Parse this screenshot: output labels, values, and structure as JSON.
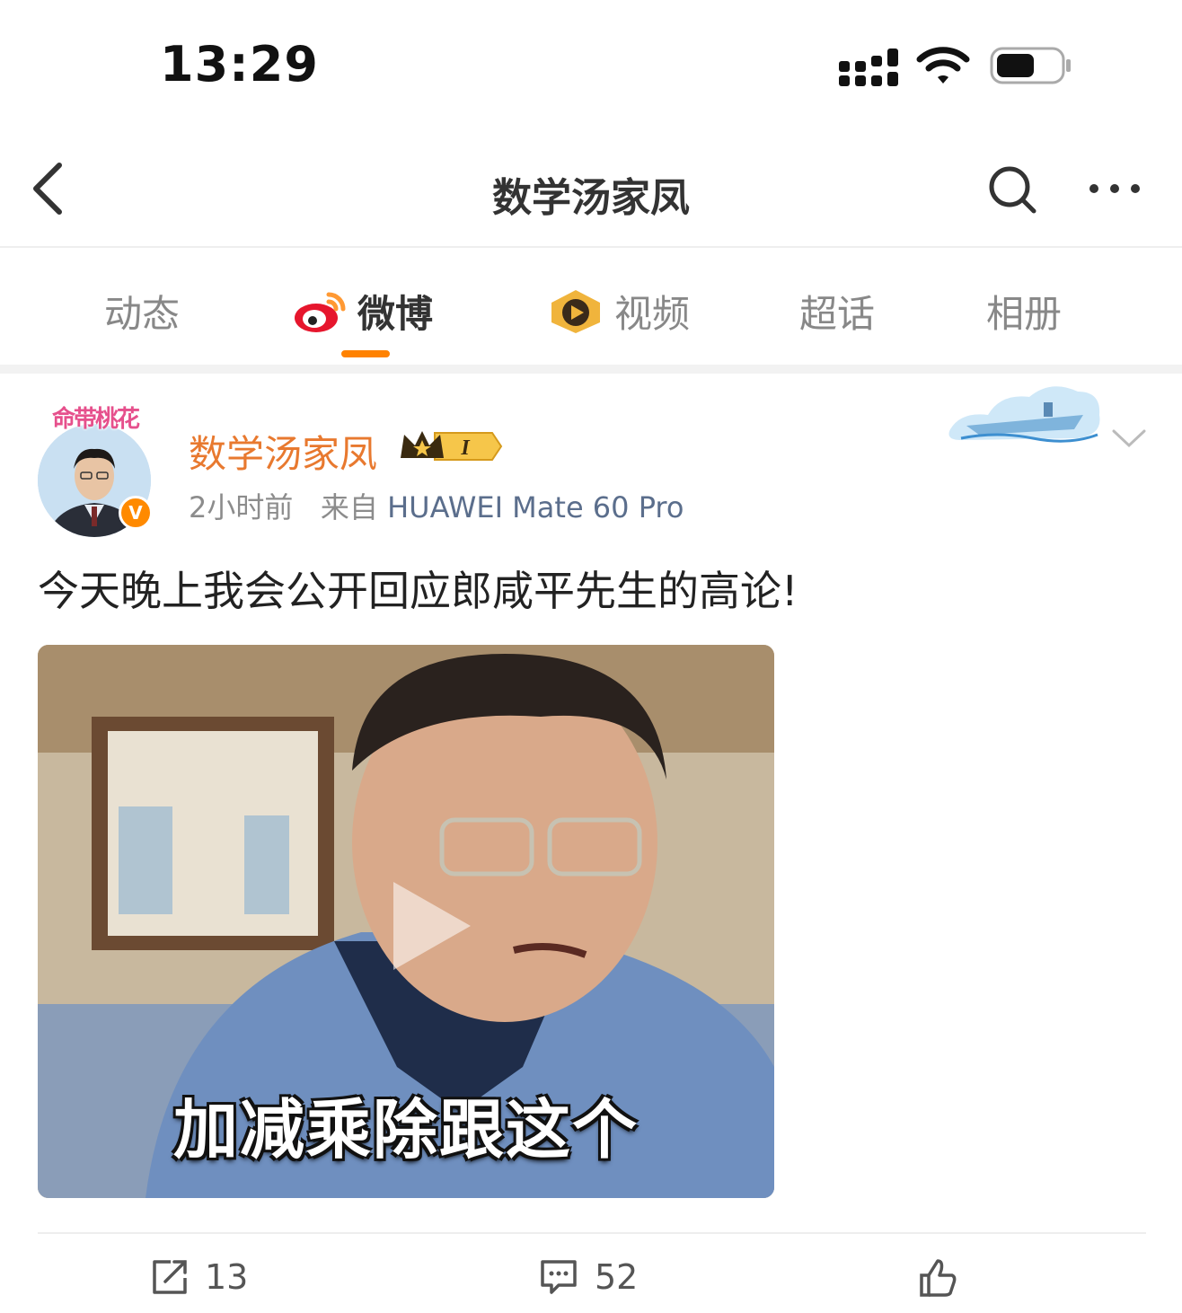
{
  "status_bar": {
    "time": "13:29",
    "battery_level": 0.6
  },
  "nav": {
    "title": "数学汤家凤"
  },
  "tabs": [
    {
      "label": "动态",
      "active": false
    },
    {
      "label": "微博",
      "active": true
    },
    {
      "label": "视频",
      "active": false
    },
    {
      "label": "超话",
      "active": false
    },
    {
      "label": "相册",
      "active": false
    }
  ],
  "post": {
    "avatar_frame_text": "命带桃花",
    "verify_mark": "V",
    "user_name": "数学汤家凤",
    "vip_level": "I",
    "time_ago": "2小时前",
    "source_prefix": "来自",
    "source_device": "HUAWEI Mate 60 Pro",
    "text": "今天晚上我会公开回应郎咸平先生的高论!",
    "video_caption": "加减乘除跟这个",
    "actions": {
      "repost_count": "13",
      "comment_count": "52"
    }
  },
  "colors": {
    "accent": "#ff8200",
    "username": "#e8792f",
    "device": "#5b6e8c"
  }
}
